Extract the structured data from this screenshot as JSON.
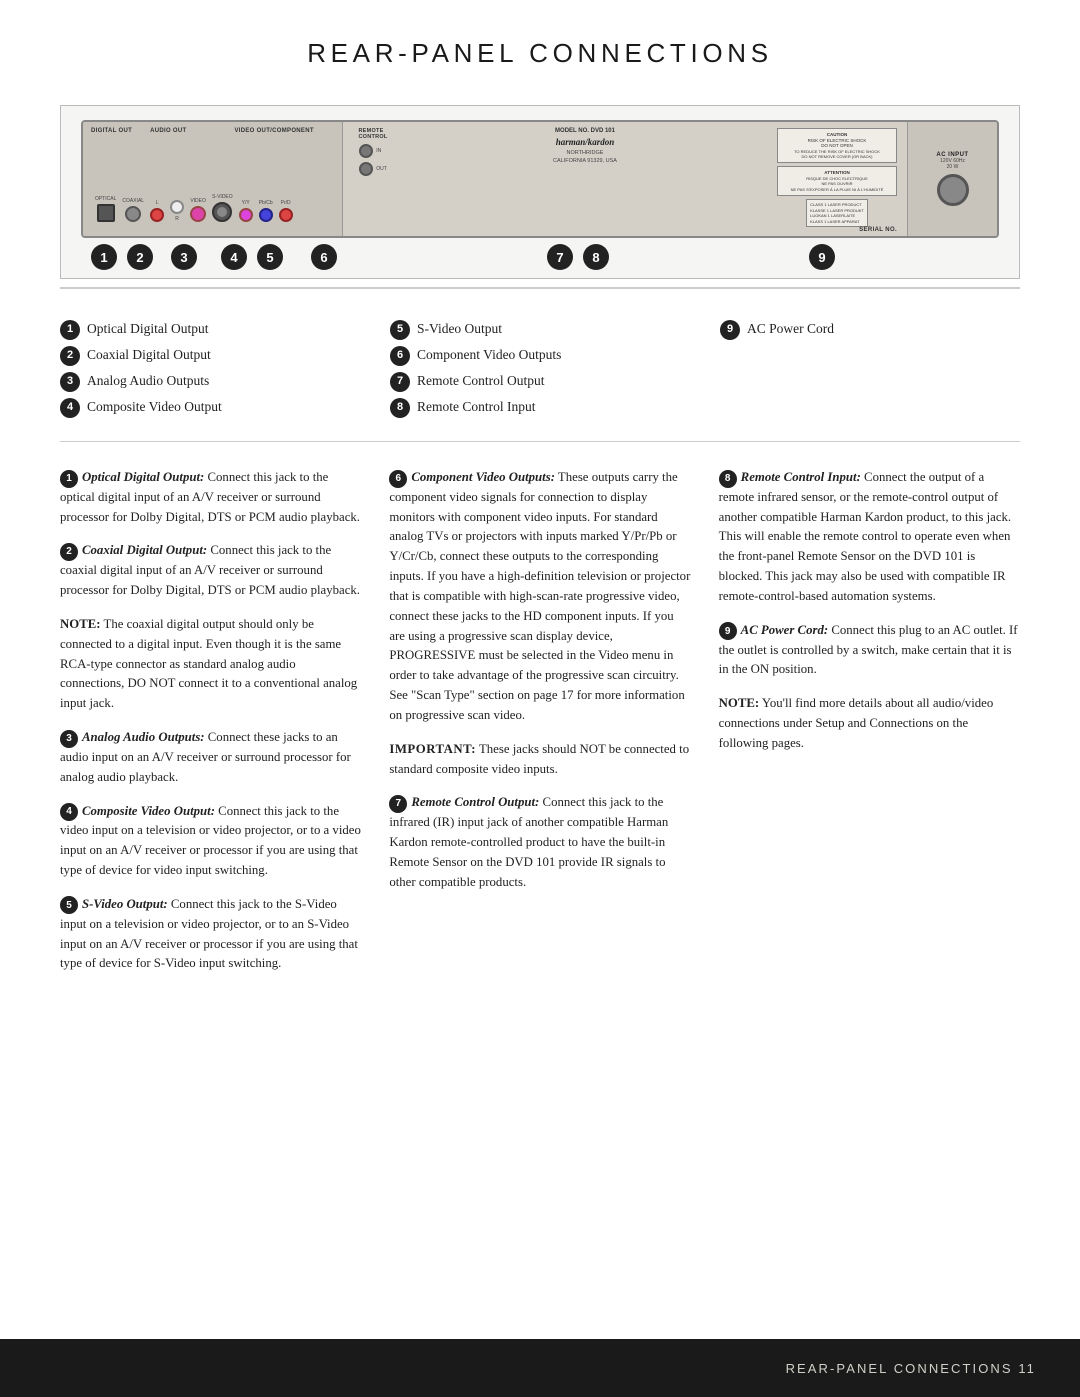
{
  "page": {
    "title": "REAR-PANEL CONNECTIONS",
    "footer_text": "REAR-PANEL CONNECTIONS   11"
  },
  "legend": {
    "items": [
      {
        "num": "1",
        "label": "Optical Digital Output"
      },
      {
        "num": "2",
        "label": "Coaxial Digital Output"
      },
      {
        "num": "3",
        "label": "Analog Audio Outputs"
      },
      {
        "num": "4",
        "label": "Composite Video Output"
      },
      {
        "num": "5",
        "label": "S-Video Output"
      },
      {
        "num": "6",
        "label": "Component Video Outputs"
      },
      {
        "num": "7",
        "label": "Remote Control Output"
      },
      {
        "num": "8",
        "label": "Remote Control Input"
      },
      {
        "num": "9",
        "label": "AC Power Cord"
      }
    ]
  },
  "descriptions": {
    "col1": [
      {
        "num": "1",
        "label": "Optical Digital Output:",
        "text": " Connect this jack to the optical digital input of an A/V receiver or surround processor for Dolby Digital, DTS or PCM audio playback."
      },
      {
        "num": "2",
        "label": "Coaxial Digital Output:",
        "text": " Connect this jack to the coaxial digital input of an A/V receiver or surround processor for Dolby Digital, DTS or PCM audio playback."
      },
      {
        "note": "NOTE:",
        "text": " The coaxial digital output should only be connected to a digital input. Even though it is the same RCA-type connector as standard analog audio connections, DO NOT connect it to a conventional analog input jack."
      },
      {
        "num": "3",
        "label": "Analog Audio Outputs:",
        "text": " Connect these jacks to an audio input on an A/V receiver or surround processor for analog audio playback."
      },
      {
        "num": "4",
        "label": "Composite Video Output:",
        "text": " Connect this jack to the video input on a television or video projector, or to a video input on an A/V receiver or processor if you are using that type of device for video input switching."
      },
      {
        "num": "5",
        "label": "S-Video Output:",
        "text": " Connect this jack to the S-Video input on a television or video projector, or to an S-Video input on an A/V receiver or processor if you are using that type of device for S-Video input switching."
      }
    ],
    "col2": [
      {
        "num": "6",
        "label": "Component Video Outputs:",
        "text": " These outputs carry the component video signals for connection to display monitors with component video inputs. For standard analog TVs or projectors with inputs marked Y/Pr/Pb or Y/Cr/Cb, connect these outputs to the corresponding inputs. If you have a high-definition television or projector that is compatible with high-scan-rate progressive video, connect these jacks to the HD component inputs. If you are using a progressive scan display device, PROGRESSIVE must be selected in the Video menu in order to take advantage of the progressive scan circuitry. See \"Scan Type\" section on page 17 for more information on progressive scan video."
      },
      {
        "important": "IMPORTANT:",
        "text": " These jacks should NOT be connected to standard composite video inputs."
      },
      {
        "num": "7",
        "label": "Remote Control Output:",
        "text": " Connect this jack to the infrared (IR) input jack of another compatible Harman Kardon remote-controlled product to have the built-in Remote Sensor on the DVD 101 provide IR signals to other compatible products."
      }
    ],
    "col3": [
      {
        "num": "8",
        "label": "Remote Control Input:",
        "text": " Connect the output of a remote infrared sensor, or the remote-control output of another compatible Harman Kardon product, to this jack. This will enable the remote control to operate even when the front-panel Remote Sensor on the DVD 101 is blocked. This jack may also be used with compatible IR remote-control-based automation systems."
      },
      {
        "num": "9",
        "label": "AC Power Cord:",
        "text": " Connect this plug to an AC outlet. If the outlet is controlled by a switch, make certain that it is in the ON position."
      },
      {
        "note": "NOTE:",
        "text": " You'll find more details about all audio/video connections under Setup and Connections on the following pages."
      }
    ]
  },
  "panel": {
    "labels": [
      "DIGITAL OUT",
      "AUDIO OUT",
      "VIDEO OUT/COMPONENT"
    ],
    "remote_label": "REMOTE CONTROL",
    "ac_label": "AC INPUT",
    "ac_spec": "120V 60Hz 20 W",
    "brand_line1": "harman/kardon",
    "model": "MODEL NO. DVD 101",
    "location": "NORTHRIDGE\nCALIFORNIA 91329, USA"
  },
  "callout_numbers": [
    "1",
    "2",
    "3",
    "4",
    "5",
    "6",
    "7",
    "8",
    "9"
  ]
}
